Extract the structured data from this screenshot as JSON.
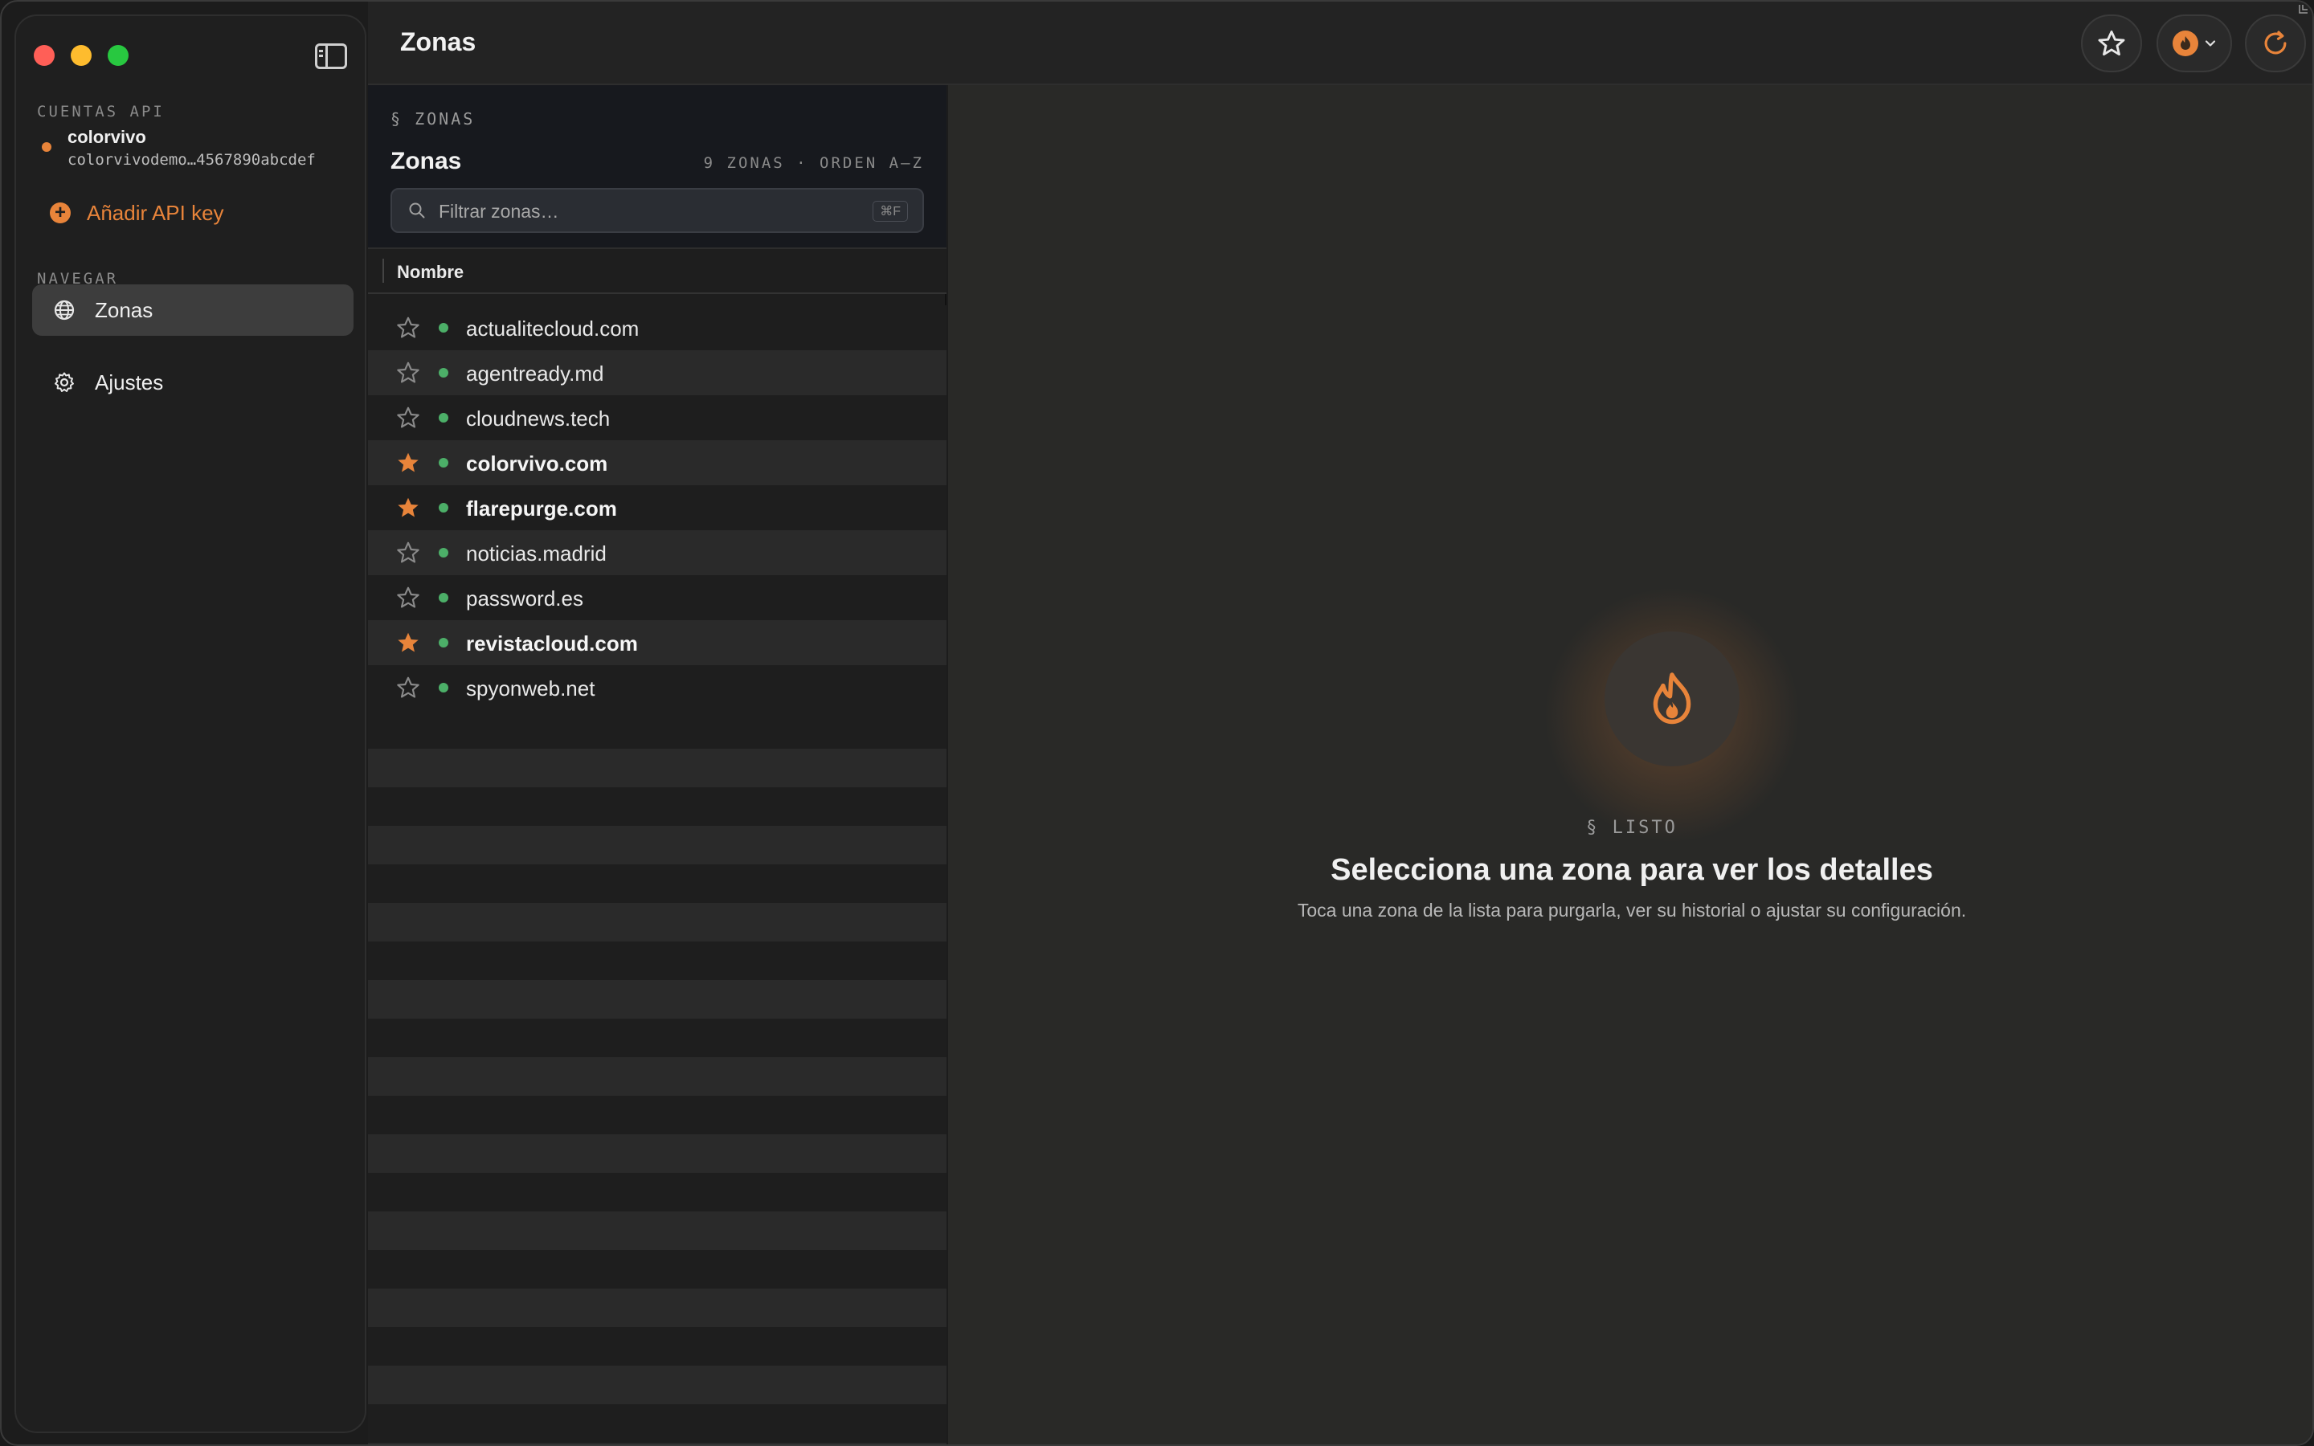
{
  "sidebar": {
    "accounts_label": "CUENTAS API",
    "account": {
      "name": "colorvivo",
      "key": "colorvivodemo…4567890abcdef"
    },
    "add_key_label": "Añadir API key",
    "nav_label": "NAVEGAR",
    "nav_items": [
      {
        "label": "Zonas",
        "icon": "globe-icon",
        "active": true
      },
      {
        "label": "Ajustes",
        "icon": "gear-icon",
        "active": false
      }
    ]
  },
  "topbar": {
    "title": "Zonas",
    "buttons": [
      "favorites-star",
      "account-switcher",
      "refresh"
    ]
  },
  "list": {
    "section": "§ ZONAS",
    "title": "Zonas",
    "meta": "9 ZONAS · ORDEN A–Z",
    "search_placeholder": "Filtrar zonas…",
    "search_shortcut": "⌘F",
    "column_header": "Nombre",
    "rows": [
      {
        "domain": "actualitecloud.com",
        "favorite": false,
        "status": "active"
      },
      {
        "domain": "agentready.md",
        "favorite": false,
        "status": "active"
      },
      {
        "domain": "cloudnews.tech",
        "favorite": false,
        "status": "active"
      },
      {
        "domain": "colorvivo.com",
        "favorite": true,
        "status": "active"
      },
      {
        "domain": "flarepurge.com",
        "favorite": true,
        "status": "active"
      },
      {
        "domain": "noticias.madrid",
        "favorite": false,
        "status": "active"
      },
      {
        "domain": "password.es",
        "favorite": false,
        "status": "active"
      },
      {
        "domain": "revistacloud.com",
        "favorite": true,
        "status": "active"
      },
      {
        "domain": "spyonweb.net",
        "favorite": false,
        "status": "active"
      }
    ]
  },
  "detail": {
    "section": "§ LISTO",
    "title": "Selecciona una zona para ver los detalles",
    "subtitle": "Toca una zona de la lista para purgarla, ver su historial o ajustar su configuración."
  },
  "colors": {
    "accent": "#e8843a",
    "status_active": "#4caf68"
  }
}
